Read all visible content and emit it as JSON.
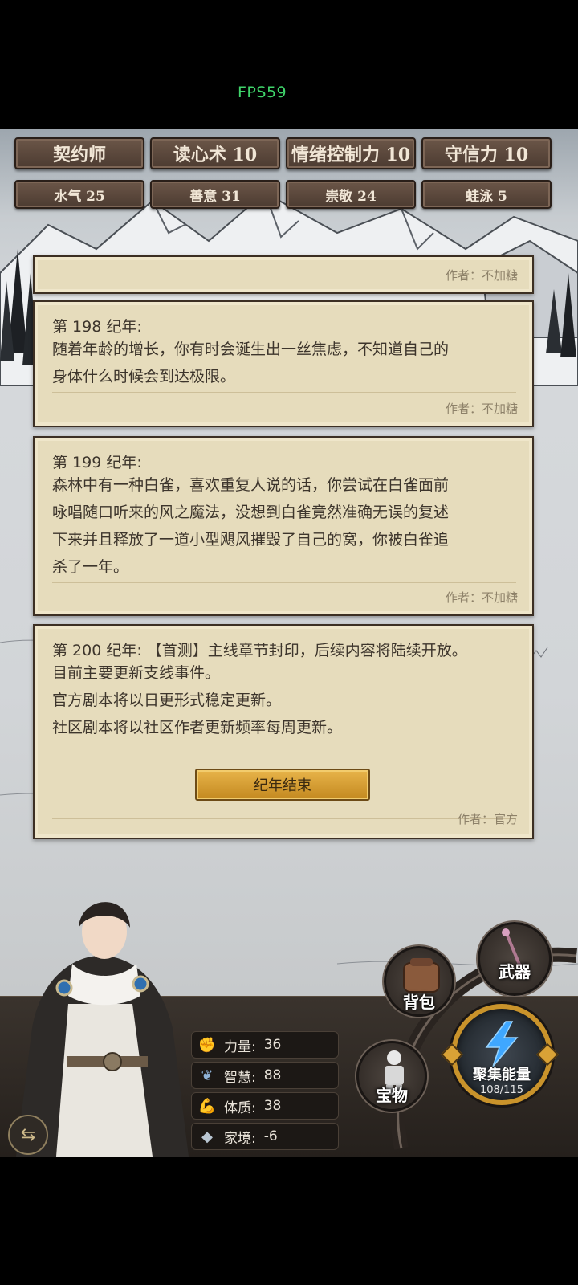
{
  "status": {
    "fps": "FPS59"
  },
  "top_stats": [
    {
      "label": "契约师"
    },
    {
      "label": "读心术 10"
    },
    {
      "label": "情绪控制力 10"
    },
    {
      "label": "守信力 10"
    }
  ],
  "sub_stats": [
    {
      "label": "水气 25"
    },
    {
      "label": "善意 31"
    },
    {
      "label": "崇敬 24"
    },
    {
      "label": "蛙泳 5"
    }
  ],
  "cards": [
    {
      "author": "作者：不加糖"
    },
    {
      "title": "第 198 纪年:",
      "body": "随着年龄的增长，你有时会诞生出一丝焦虑，不知道自己的\n身体什么时候会到达极限。",
      "author": "作者：不加糖"
    },
    {
      "title": "第 199 纪年:",
      "body": "森林中有一种白雀，喜欢重复人说的话，你尝试在白雀面前\n咏唱随口听来的风之魔法，没想到白雀竟然准确无误的复述\n下来并且释放了一道小型飓风摧毁了自己的窝，你被白雀追\n杀了一年。",
      "author": "作者：不加糖"
    },
    {
      "title": "第 200 纪年: 【首测】主线章节封印，后续内容将陆续开放。",
      "body": "目前主要更新支线事件。\n官方剧本将以日更形式稳定更新。\n社区剧本将以社区作者更新频率每周更新。",
      "button": "纪年结束",
      "author": "作者：官方"
    }
  ],
  "attributes": [
    {
      "label": "力量:",
      "value": "36",
      "icon": "fist-icon"
    },
    {
      "label": "智慧:",
      "value": "88",
      "icon": "brain-icon"
    },
    {
      "label": "体质:",
      "value": "38",
      "icon": "muscle-arm-icon"
    },
    {
      "label": "家境:",
      "value": "-6",
      "icon": "diamond-icon"
    }
  ],
  "actions": {
    "weapon": "武器",
    "backpack": "背包",
    "treasure": "宝物",
    "gather_energy": "聚集能量",
    "energy_value": "108/115"
  },
  "colors": {
    "fps": "#3fd46a",
    "chip": "#5b4a3d",
    "card": "#e6dcbc",
    "button_gold": "#d9a236"
  }
}
